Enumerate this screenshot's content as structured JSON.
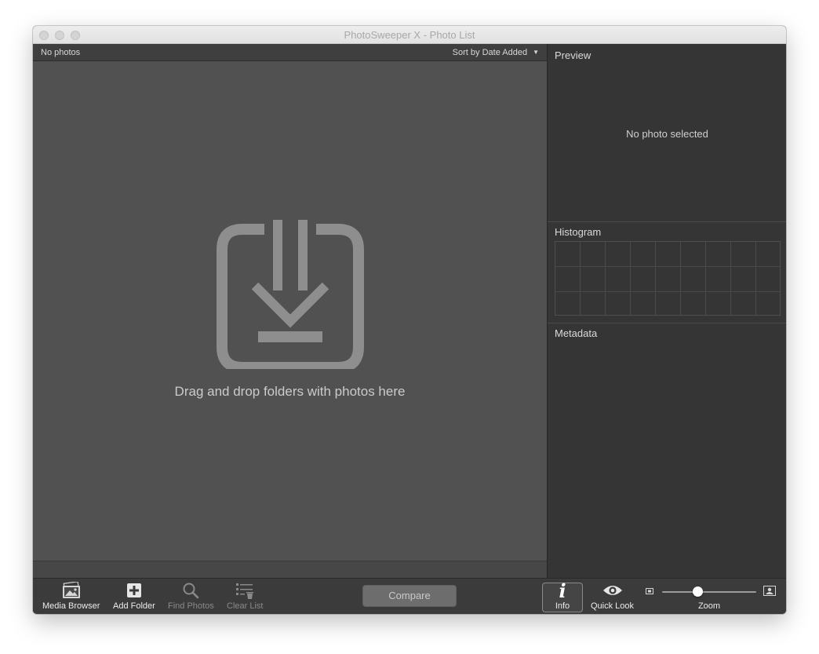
{
  "window": {
    "title": "PhotoSweeper X - Photo List"
  },
  "photo_list": {
    "count_label": "No photos",
    "sort_label": "Sort by Date Added",
    "drop_hint": "Drag and drop folders with photos here"
  },
  "sidebar": {
    "preview": {
      "title": "Preview",
      "empty_text": "No photo selected"
    },
    "histogram": {
      "title": "Histogram"
    },
    "metadata": {
      "title": "Metadata"
    }
  },
  "toolbar": {
    "media_browser": "Media Browser",
    "add_folder": "Add Folder",
    "find_photos": "Find Photos",
    "clear_list": "Clear List",
    "compare": "Compare",
    "info": "Info",
    "info_glyph": "i",
    "quick_look": "Quick Look",
    "zoom": {
      "label": "Zoom",
      "level": 0.38
    }
  },
  "colors": {
    "list_background": "#515151",
    "sidebar_background": "#353535",
    "toolbar_background": "#3b3b3b",
    "drop_icon": "#8e8e8e"
  },
  "icons": [
    "media-browser-icon",
    "add-folder-icon",
    "find-photos-icon",
    "clear-list-icon",
    "info-icon",
    "quick-look-icon",
    "zoom-small-icon",
    "zoom-large-icon",
    "drop-folder-icon"
  ]
}
